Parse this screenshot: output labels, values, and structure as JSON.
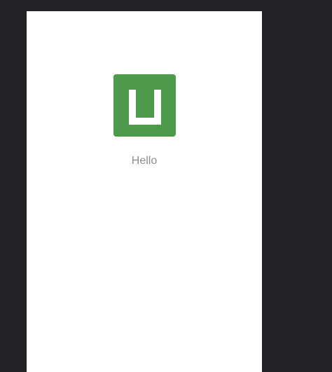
{
  "app": {
    "logo_icon": "app-logo-icon",
    "logo_color": "#4c9a4a",
    "greeting": "Hello"
  },
  "theme": {
    "background": "#222226",
    "surface": "#ffffff",
    "text_muted": "#8c8c8c"
  }
}
